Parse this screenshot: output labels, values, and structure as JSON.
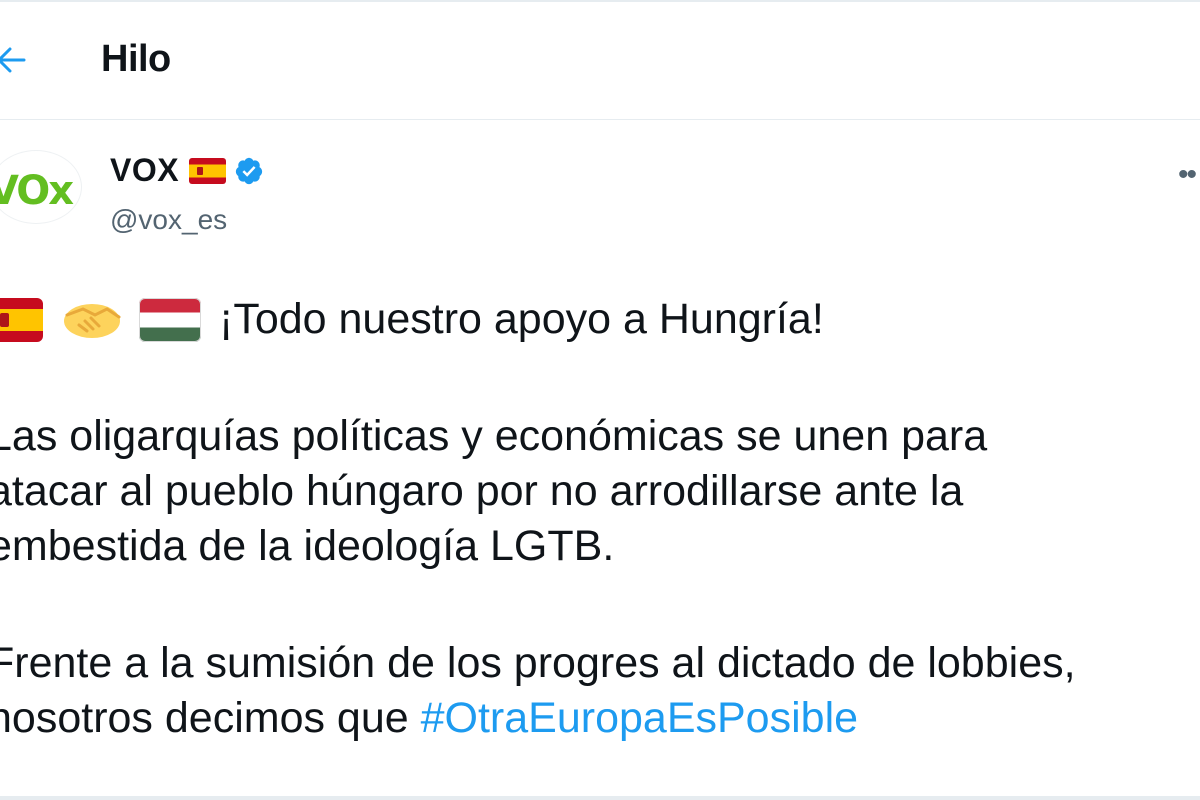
{
  "header": {
    "title": "Hilo",
    "back_icon": "arrow-left-icon",
    "accent": "#1d9bf0"
  },
  "tweet": {
    "author": {
      "display_name": "VOX",
      "name_flag_icon": "spain-flag-icon",
      "verified_icon": "verified-badge-icon",
      "handle": "@vox_es",
      "avatar_text": "VOx",
      "avatar_color": "#63be21"
    },
    "more_icon": "more-options-icon",
    "first_line_emojis": [
      "spain-flag-emoji",
      "handshake-emoji",
      "hungary-flag-emoji"
    ],
    "first_line_text": "¡Todo nuestro apoyo a Hungría!",
    "paragraph2": [
      "Las oligarquías políticas y económicas se unen para",
      "atacar al pueblo húngaro por no arrodillarse ante la",
      "embestida de la ideología LGTB."
    ],
    "paragraph3_line1": "Frente a la sumisión de los progres al dictado de lobbies,",
    "paragraph3_line2_text": "nosotros decimos que ",
    "hashtag": "#OtraEuropaEsPosible",
    "hashtag_color": "#1d9bf0"
  }
}
